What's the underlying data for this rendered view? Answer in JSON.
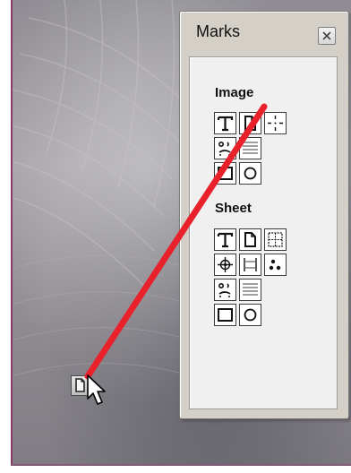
{
  "palette": {
    "title": "Marks",
    "close_icon": "close-icon",
    "sections": {
      "image": {
        "label": "Image",
        "tools": [
          "text-mark-icon",
          "page-mark-icon",
          "registration-mark-icon",
          "face-mark-icon",
          "lines-mark-icon",
          "rectangle-mark-icon",
          "circle-mark-icon"
        ]
      },
      "sheet": {
        "label": "Sheet",
        "tools": [
          "text-mark-icon",
          "page-mark-icon",
          "grid-mark-icon",
          "crosshair-mark-icon",
          "bleed-mark-icon",
          "dots-mark-icon",
          "face-mark-icon",
          "lines-mark-icon",
          "rectangle-mark-icon",
          "circle-mark-icon"
        ]
      }
    }
  },
  "colors": {
    "drag_line": "#e8212b",
    "palette_bg": "#d4d0c8",
    "panel_bg": "#f0f0f0"
  },
  "canvas": {
    "dragged_item_icon": "page-mark-icon",
    "cursor_icon": "arrow-cursor-icon"
  }
}
